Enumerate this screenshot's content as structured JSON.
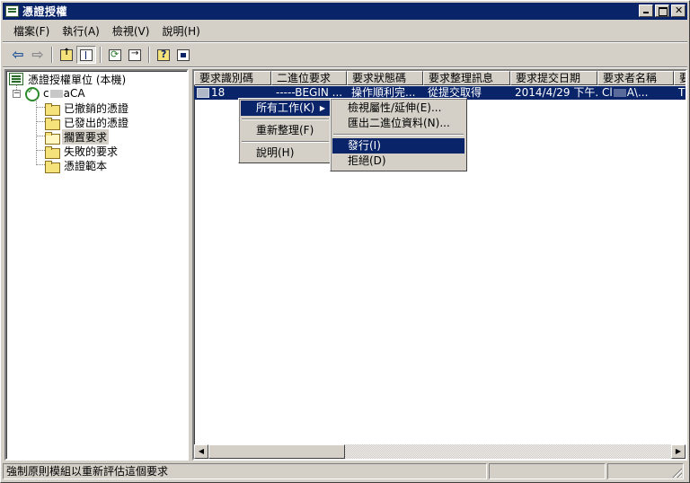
{
  "window": {
    "title": "憑證授權"
  },
  "menubar": [
    "檔案(F)",
    "執行(A)",
    "檢視(V)",
    "說明(H)"
  ],
  "tree": {
    "root": "憑證授權單位 (本機)",
    "ca_prefix": "c",
    "ca_suffix": "aCA",
    "folders": [
      "已撤銷的憑證",
      "已發出的憑證",
      "擱置要求",
      "失敗的要求",
      "憑證範本"
    ],
    "selected_index": 2
  },
  "list": {
    "columns": [
      "要求識別碼",
      "二進位要求",
      "要求狀態碼",
      "要求整理訊息",
      "要求提交日期",
      "要求者名稱",
      "要"
    ],
    "rows": [
      {
        "id": "18",
        "binary": "-----BEGIN ...",
        "status": "操作順利完...",
        "disposition": "從提交取得",
        "date": "2014/4/29 下午...",
        "requester_prefix": "Cl",
        "requester_suffix": "A\\...",
        "extra": "T"
      }
    ]
  },
  "context_menu": {
    "items": [
      "所有工作(K)",
      "重新整理(F)",
      "說明(H)"
    ],
    "highlighted_index": 0
  },
  "submenu": {
    "items": [
      "檢視屬性/延伸(E)...",
      "匯出二進位資料(N)...",
      "發行(I)",
      "拒絕(D)"
    ],
    "highlighted_index": 2
  },
  "statusbar": {
    "text": "強制原則模組以重新評估這個要求"
  }
}
